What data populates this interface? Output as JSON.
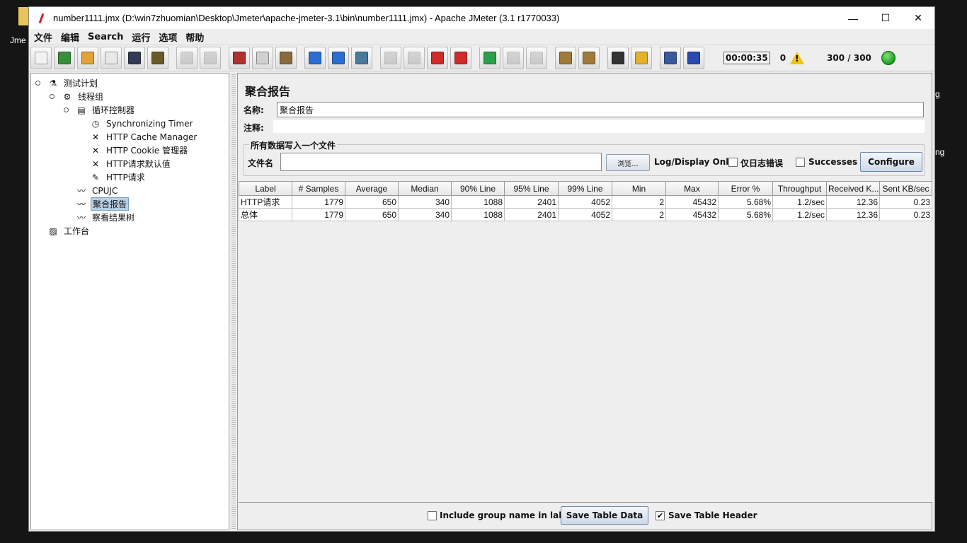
{
  "desktop": {
    "left_label": "Jme",
    "right_label_1": "g",
    "right_label_2": "ng"
  },
  "window": {
    "title": "number1111.jmx (D:\\win7zhuomian\\Desktop\\Jmeter\\apache-jmeter-3.1\\bin\\number1111.jmx) - Apache JMeter (3.1 r1770033)",
    "minimize": "—",
    "maximize": "☐",
    "close": "✕"
  },
  "menu": [
    "文件",
    "编辑",
    "Search",
    "运行",
    "选项",
    "帮助"
  ],
  "toolbar": {
    "buttons": [
      {
        "icon": "new-icon",
        "color": "#f2f2f2"
      },
      {
        "icon": "templates-icon",
        "color": "#3a8f3a"
      },
      {
        "icon": "open-icon",
        "color": "#e3a13a"
      },
      {
        "icon": "close-file-icon",
        "color": "#e8e8e8"
      },
      {
        "icon": "save-icon",
        "color": "#333a55"
      },
      {
        "icon": "save-as-icon",
        "color": "#6a5a2a"
      },
      {
        "icon": "undo-icon",
        "color": "#9a9a9a"
      },
      {
        "icon": "redo-icon",
        "color": "#9a9a9a"
      },
      {
        "icon": "cut-icon",
        "color": "#b03030"
      },
      {
        "icon": "copy-icon",
        "color": "#d0d0d0"
      },
      {
        "icon": "paste-icon",
        "color": "#8a6a3a"
      },
      {
        "icon": "expand-icon",
        "color": "#2a6ed1"
      },
      {
        "icon": "collapse-icon",
        "color": "#2a6ed1"
      },
      {
        "icon": "toggle-icon",
        "color": "#4a7a9a"
      },
      {
        "icon": "start-icon",
        "color": "#9a9a9a"
      },
      {
        "icon": "start-no-pause-icon",
        "color": "#9a9a9a"
      },
      {
        "icon": "stop-icon",
        "color": "#d12a2a"
      },
      {
        "icon": "shutdown-icon",
        "color": "#d12a2a"
      },
      {
        "icon": "remote-start-icon",
        "color": "#2aa04a"
      },
      {
        "icon": "remote-stop-icon",
        "color": "#9a9a9a"
      },
      {
        "icon": "remote-shutdown-icon",
        "color": "#9a9a9a"
      },
      {
        "icon": "clear-icon",
        "color": "#a07a3a"
      },
      {
        "icon": "clear-all-icon",
        "color": "#a07a3a"
      },
      {
        "icon": "search-icon",
        "color": "#333333"
      },
      {
        "icon": "reset-search-icon",
        "color": "#e3b12a"
      },
      {
        "icon": "function-helper-icon",
        "color": "#3a5aa0"
      },
      {
        "icon": "help-icon",
        "color": "#2a4ab1"
      }
    ],
    "timer": "00:00:35",
    "error_count": "0",
    "threads": "300 / 300"
  },
  "tree": [
    {
      "label": "测试计划",
      "icon": "test-plan-icon",
      "level": 0
    },
    {
      "label": "线程组",
      "icon": "thread-group-icon",
      "level": 1
    },
    {
      "label": "循环控制器",
      "icon": "loop-controller-icon",
      "level": 2
    },
    {
      "label": "Synchronizing Timer",
      "icon": "timer-icon",
      "level": 3
    },
    {
      "label": "HTTP Cache Manager",
      "icon": "config-wrench-icon",
      "level": 3
    },
    {
      "label": "HTTP Cookie 管理器",
      "icon": "config-wrench-icon",
      "level": 3
    },
    {
      "label": "HTTP请求默认值",
      "icon": "config-wrench-icon",
      "level": 3
    },
    {
      "label": "HTTP请求",
      "icon": "sampler-pen-icon",
      "level": 3
    },
    {
      "label": "CPUJC",
      "icon": "listener-graph-icon",
      "level": 2
    },
    {
      "label": "聚合报告",
      "icon": "listener-graph-icon",
      "level": 2,
      "selected": true
    },
    {
      "label": "察看结果树",
      "icon": "listener-graph-icon",
      "level": 2
    },
    {
      "label": "工作台",
      "icon": "workbench-icon",
      "level": 0
    }
  ],
  "panel": {
    "title": "聚合报告",
    "name_label": "名称:",
    "name_value": "聚合报告",
    "comment_label": "注释:",
    "group_title": "所有数据写入一个文件",
    "file_label": "文件名",
    "browse_label": "浏览...",
    "log_only_label": "Log/Display Only:",
    "errors_label": "仅日志错误",
    "successes_label": "Successes",
    "configure_label": "Configure"
  },
  "table": {
    "columns": [
      "Label",
      "# Samples",
      "Average",
      "Median",
      "90% Line",
      "95% Line",
      "99% Line",
      "Min",
      "Max",
      "Error %",
      "Throughput",
      "Received K...",
      "Sent KB/sec"
    ],
    "rows": [
      [
        "HTTP请求",
        "1779",
        "650",
        "340",
        "1088",
        "2401",
        "4052",
        "2",
        "45432",
        "5.68%",
        "1.2/sec",
        "12.36",
        "0.23"
      ],
      [
        "总体",
        "1779",
        "650",
        "340",
        "1088",
        "2401",
        "4052",
        "2",
        "45432",
        "5.68%",
        "1.2/sec",
        "12.36",
        "0.23"
      ]
    ]
  },
  "bottom": {
    "include_group_label": "Include group name in label?",
    "save_table_label": "Save Table Data",
    "save_header_label": "Save Table Header",
    "include_group_checked": false,
    "save_header_checked": true
  }
}
